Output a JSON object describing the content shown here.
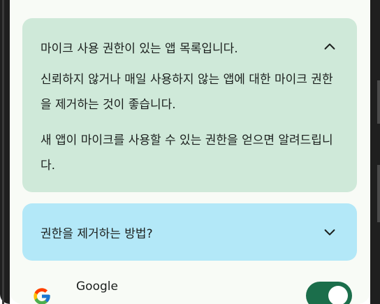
{
  "cards": {
    "mic_apps": {
      "title": "마이크 사용 권한이 있는 앱 목록입니다.",
      "paragraph_1": "신뢰하지 않거나 매일 사용하지 않는 앱에 대한 마이크 권한을 제거하는 것이 좋습니다.",
      "paragraph_2": "새 앱이 마이크를 사용할 수 있는 권한을 얻으면 알려드립니다.",
      "expanded": true,
      "icon": "chevron-up-icon"
    },
    "how_to_remove": {
      "title": "권한을 제거하는 방법?",
      "expanded": false,
      "icon": "chevron-down-icon"
    }
  },
  "apps": [
    {
      "name": "Google",
      "icon": "google-g-icon",
      "permission_on": true
    }
  ],
  "colors": {
    "screen_bg": "#f8fbf6",
    "green_card": "#cfe9d9",
    "blue_card": "#b3e8f8",
    "toggle_on": "#1b6e4b"
  }
}
